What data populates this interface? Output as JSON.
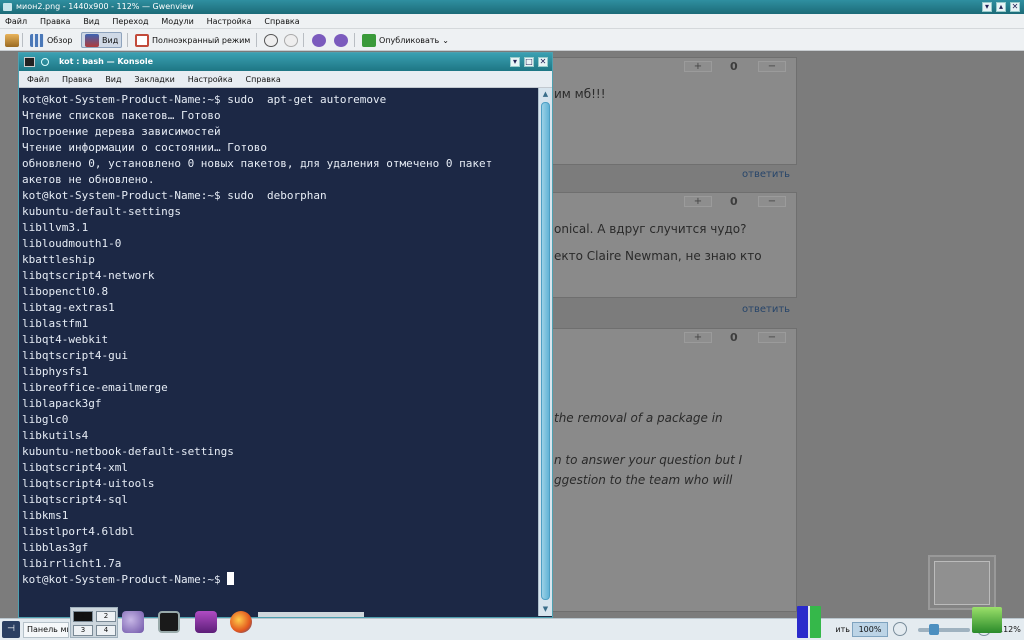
{
  "gwenview": {
    "title": "мион2.png - 1440x900 - 112% — Gwenview",
    "menu": [
      "Файл",
      "Правка",
      "Вид",
      "Переход",
      "Модули",
      "Настройка",
      "Справка"
    ],
    "toolbar": {
      "browse": "Обзор",
      "view": "Вид",
      "fullscreen": "Полноэкранный режим",
      "publish": "Опубликовать"
    },
    "comments": {
      "vote_plus": "+",
      "vote_minus": "−",
      "counts": [
        "0",
        "0",
        "0"
      ],
      "texts": [
        "им мб!!!",
        "onical. А вдруг случится чудо?",
        "екто Claire Newman, не знаю кто",
        "the removal of a package in",
        "n to answer your question but I",
        "ggestion to the team who will"
      ],
      "reply_label": "ответить"
    }
  },
  "konsole": {
    "title": "kot : bash — Konsole",
    "menu": [
      "Файл",
      "Правка",
      "Вид",
      "Закладки",
      "Настройка",
      "Справка"
    ],
    "lines": [
      "kot@kot-System-Product-Name:~$ sudo  apt-get autoremove",
      "Чтение списков пакетов… Готово",
      "Построение дерева зависимостей",
      "Чтение информации о состоянии… Готово",
      "обновлено 0, установлено 0 новых пакетов, для удаления отмечено 0 пакет",
      "акетов не обновлено.",
      "kot@kot-System-Product-Name:~$ sudo  deborphan",
      "kubuntu-default-settings",
      "libllvm3.1",
      "libloudmouth1-0",
      "kbattleship",
      "libqtscript4-network",
      "libopenctl0.8",
      "libtag-extras1",
      "liblastfm1",
      "libqt4-webkit",
      "libqtscript4-gui",
      "libphysfs1",
      "libreoffice-emailmerge",
      "liblapack3gf",
      "libglc0",
      "libkutils4",
      "kubuntu-netbook-default-settings",
      "libqtscript4-xml",
      "libqtscript4-uitools",
      "libqtscript4-sql",
      "libkms1",
      "libstlport4.6ldbl",
      "libblas3gf",
      "libirrlicht1.7a"
    ],
    "prompt": "kot@kot-System-Product-Name:~$"
  },
  "taskbar": {
    "panel_label": "Панель ми",
    "pager": [
      "1",
      "2",
      "3",
      "4"
    ],
    "zoom_label": "ить",
    "zoom_value": "100%",
    "zoom_percent": "112%",
    "slider_level": 0.27
  },
  "colors": {
    "terminal_bg": "#1c2845",
    "terminal_fg": "#e6ecf5",
    "titlebar": "#2f8fa0"
  }
}
